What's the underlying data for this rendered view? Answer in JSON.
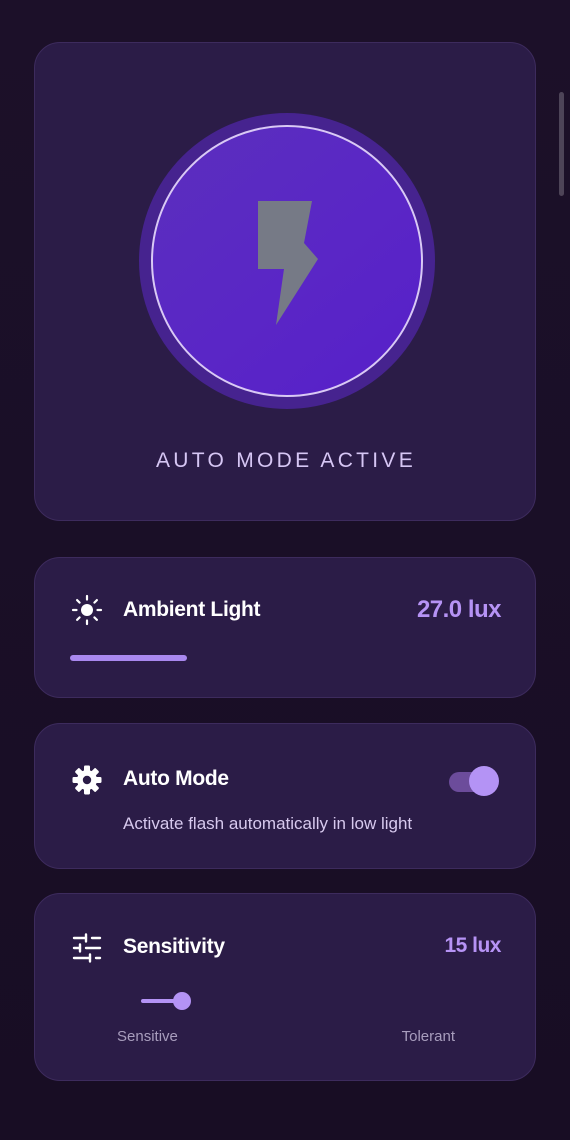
{
  "hero": {
    "status_text": "AUTO MODE ACTIVE",
    "flash_icon": "lightning-bolt-icon"
  },
  "ambient": {
    "icon": "sun-icon",
    "label": "Ambient Light",
    "value": "27.0 lux",
    "level_fraction": 0.27
  },
  "auto_mode": {
    "icon": "gear-icon",
    "label": "Auto Mode",
    "description": "Activate flash automatically in low light",
    "enabled": true
  },
  "sensitivity": {
    "icon": "sliders-icon",
    "label": "Sensitivity",
    "value": "15 lux",
    "slider_fraction": 0.12,
    "min_label": "Sensitive",
    "max_label": "Tolerant"
  },
  "colors": {
    "accent": "#b693f5",
    "card_background": "#2b1c47",
    "flash_button": "#5a26c6",
    "page_background": "#1a0f27"
  }
}
